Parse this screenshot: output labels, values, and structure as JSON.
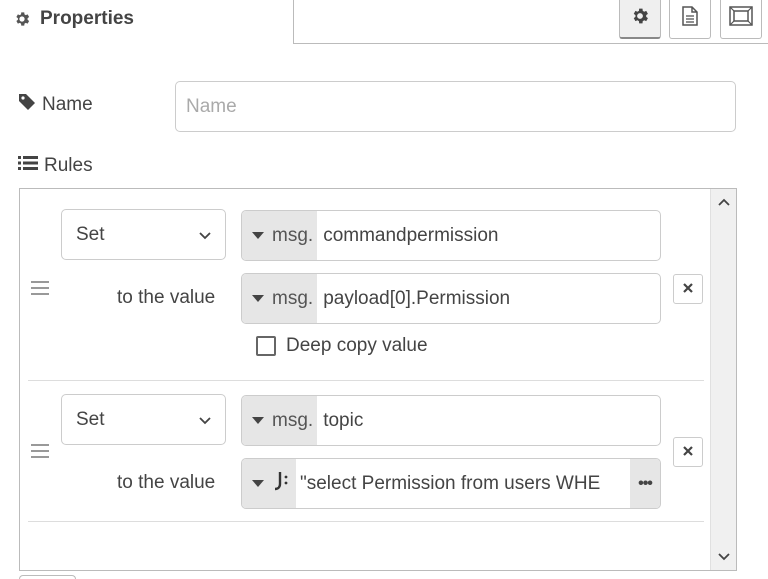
{
  "header": {
    "title": "Properties",
    "title_icon": "gear-icon",
    "buttons": [
      {
        "icon": "gear-icon",
        "active": true
      },
      {
        "icon": "document-icon",
        "active": false
      },
      {
        "icon": "appearance-icon",
        "active": false
      }
    ]
  },
  "name_field": {
    "label": "Name",
    "icon": "tag-icon",
    "value": "",
    "placeholder": "Name"
  },
  "rules": {
    "label": "Rules",
    "icon": "list-icon",
    "to_value_label": "to the value",
    "items": [
      {
        "action": "Set",
        "target_type": "msg.",
        "target": "commandpermission",
        "to_label": "to the value",
        "value_type": "msg.",
        "value": "payload[0].Permission",
        "deep_copy_label": "Deep copy value",
        "deep_copy_checked": false
      },
      {
        "action": "Set",
        "target_type": "msg.",
        "target": "topic",
        "to_label": "to the value",
        "value_type_icon": "jsonata-icon",
        "value": "\"select Permission from users WHE",
        "expand_label": "•••"
      }
    ]
  },
  "colors": {
    "type_bg": "#e6e6e6",
    "border": "#cccccc",
    "text": "#444444"
  }
}
